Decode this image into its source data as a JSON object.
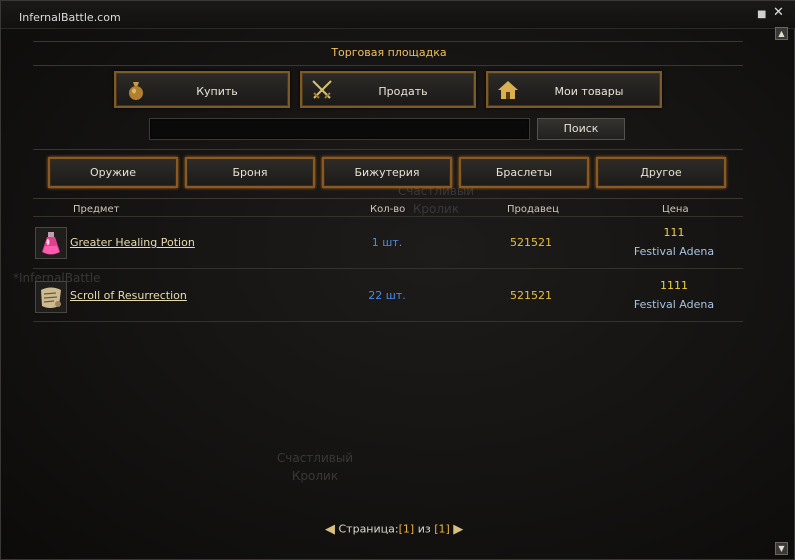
{
  "window": {
    "title": "InfernalBattle.com"
  },
  "market": {
    "title": "Торговая площадка"
  },
  "actions": [
    {
      "label": "Купить",
      "icon": "money-bag-icon"
    },
    {
      "label": "Продать",
      "icon": "crossed-swords-icon"
    },
    {
      "label": "Мои товары",
      "icon": "house-icon"
    }
  ],
  "search": {
    "value": "",
    "button_label": "Поиск"
  },
  "categories": [
    "Оружие",
    "Броня",
    "Бижутерия",
    "Браслеты",
    "Другое"
  ],
  "table": {
    "headers": {
      "item": "Предмет",
      "qty": "Кол-во",
      "seller": "Продавец",
      "price": "Цена"
    },
    "rows": [
      {
        "name": "Greater Healing Potion",
        "icon": "potion-icon",
        "qty": "1 шт.",
        "seller": "521521",
        "price": "111",
        "currency": "Festival Adena"
      },
      {
        "name": "Scroll of Resurrection",
        "icon": "scroll-icon",
        "qty": "22 шт.",
        "seller": "521521",
        "price": "1111",
        "currency": "Festival Adena"
      }
    ]
  },
  "background_text": {
    "ghost1a": "Счастливый",
    "ghost1b": "Кролик",
    "ghost2": "*InfernalBattle",
    "ghost3a": "Счастливый",
    "ghost3b": "Кролик"
  },
  "pagination": {
    "label": "Страница:",
    "current": "[1]",
    "separator": "из",
    "total": "[1]"
  },
  "colors": {
    "accent": "#f0c060",
    "button_border": "#8a5a24",
    "qty": "#4a8ce8",
    "price": "#f0d040"
  }
}
